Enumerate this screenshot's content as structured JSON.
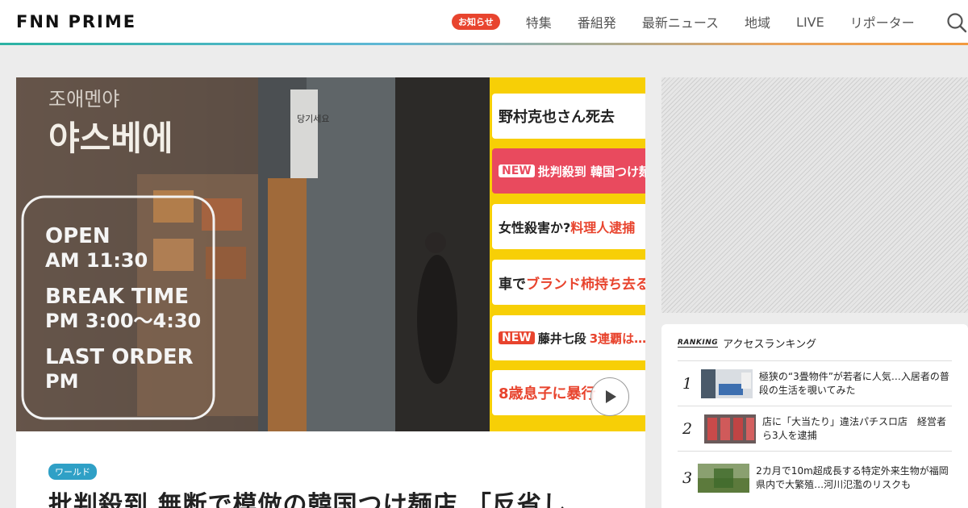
{
  "header": {
    "logo_fnn": "FNN",
    "logo_prime": "PRIME",
    "badge": "お知らせ",
    "nav": [
      "特集",
      "番組発",
      "最新ニュース",
      "地域",
      "LIVE",
      "リポーター"
    ]
  },
  "hero": {
    "sign_korean_top": "조애멘야",
    "sign_korean_name": "야스베에",
    "door_plate": "당기세요",
    "hours": [
      "OPEN",
      "AM 11:30",
      "BREAK TIME",
      "PM 3:00～4:30",
      "LAST ORDER",
      "PM"
    ],
    "ticker": [
      {
        "new": "",
        "text": "野村克也さん死去",
        "highlight": ""
      },
      {
        "new": "NEW",
        "text": "批判殺到 韓国つけ麺店",
        "highlight": ""
      },
      {
        "new": "",
        "text": "女性殺害か?",
        "highlight": "料理人逮捕"
      },
      {
        "new": "",
        "text": "車で",
        "highlight": "ブランド柿持ち去る"
      },
      {
        "new": "NEW",
        "text": "藤井七段",
        "highlight": "3連覇は…"
      },
      {
        "new": "",
        "text": "",
        "highlight": "8歳息子に暴行"
      }
    ]
  },
  "article": {
    "category": "ワールド",
    "headline": "批判殺到 無断で模倣の韓国つけ麺店 「反省し"
  },
  "ranking": {
    "tag": "RANKING",
    "title": "アクセスランキング",
    "items": [
      {
        "rank": "1",
        "text": "極狭の“3畳物件”が若者に人気…入居者の普段の生活を覗いてみた"
      },
      {
        "rank": "2",
        "text": "店に「大当たり」違法パチスロ店　経営者ら3人を逮捕"
      },
      {
        "rank": "3",
        "text": "2カ月で10m超成長する特定外来生物が福岡県内で大繁殖…河川氾濫のリスクも"
      }
    ]
  },
  "colors": {
    "accent_red": "#e8442e",
    "ticker_yellow": "#f7cf06",
    "category_blue": "#2fa0c6"
  },
  "icons": [
    "search-icon",
    "play-icon"
  ]
}
